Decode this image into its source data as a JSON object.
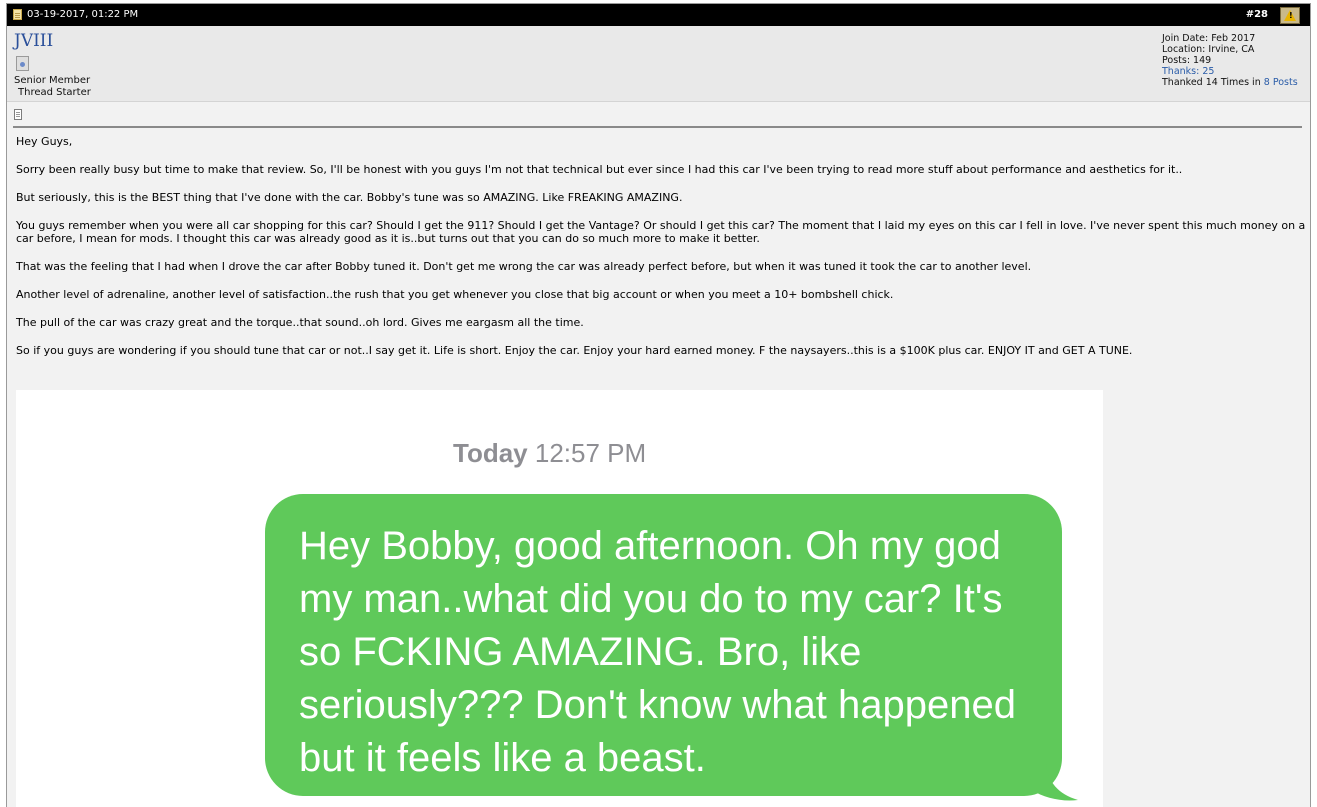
{
  "post": {
    "date": "03-19-2017, 01:22 PM",
    "number": "#28"
  },
  "user": {
    "name": "JVIII",
    "title": "Senior Member",
    "starter": "Thread Starter",
    "join_date": "Join Date: Feb 2017",
    "location": "Location: Irvine, CA",
    "posts": "Posts: 149",
    "thanks_link": "Thanks: 25",
    "thanked_prefix": "Thanked 14 Times in",
    "thanked_posts_link": "8 Posts"
  },
  "body": {
    "paragraphs": [
      "Hey Guys,",
      "Sorry been really busy but time to make that review. So, I'll be honest with you guys I'm not that technical but ever since I had this car I've been trying to read more stuff about performance and aesthetics for it..",
      "But seriously, this is the BEST thing that I've done with the car. Bobby's tune was so AMAZING. Like FREAKING AMAZING.",
      "You guys remember when you were all car shopping for this car? Should I get the 911? Should I get the Vantage? Or should I get this car? The moment that I laid my eyes on this car I fell in love. I've never spent this much money on a car before, I mean for mods. I thought this car was already good as it is..but turns out that you can do so much more to make it better.",
      "That was the feeling that I had when I drove the car after Bobby tuned it. Don't get me wrong the car was already perfect before, but when it was tuned it took the car to another level.",
      "Another level of adrenaline, another level of satisfaction..the rush that you get whenever you close that big account or when you meet a 10+ bombshell chick.",
      "The pull of the car was crazy great and the torque..that sound..oh lord. Gives me eargasm all the time.",
      "So if you guys are wondering if you should tune that car or not..I say get it. Life is short. Enjoy the car. Enjoy your hard earned money. F the naysayers..this is a $100K plus car. ENJOY IT and GET A TUNE."
    ]
  },
  "screenshot": {
    "day": "Today",
    "time": "12:57 PM",
    "message": "Hey Bobby, good afternoon. Oh my god my man..what did you do to my car? It's so FCKING AMAZING. Bro, like seriously??? Don't know what happened but it feels like a beast."
  },
  "icons": {
    "post_header": "document-icon",
    "report": "warning-icon",
    "user_status": "status-image-icon",
    "post_icon": "post-icon"
  },
  "colors": {
    "header_bg": "#000000",
    "username": "#2a4f9a",
    "link": "#2a5ca8",
    "bubble": "#5fc95a"
  }
}
